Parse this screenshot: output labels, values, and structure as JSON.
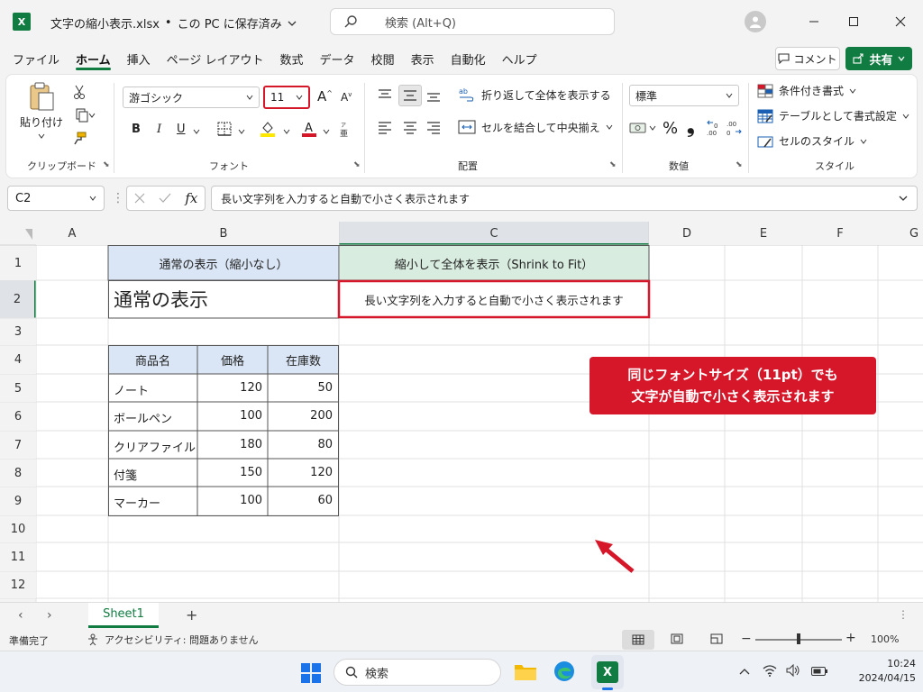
{
  "title_bar": {
    "file_name": "文字の縮小表示.xlsx",
    "dot": "•",
    "save_status": "この PC に保存済み",
    "search_placeholder": "検索 (Alt+Q)"
  },
  "menu": [
    "ファイル",
    "ホーム",
    "挿入",
    "ページ レイアウト",
    "数式",
    "データ",
    "校閲",
    "表示",
    "自動化",
    "ヘルプ"
  ],
  "menu_active": "ホーム",
  "comment_button": "コメント",
  "share_button": "共有",
  "ribbon": {
    "paste_label": "貼り付け",
    "clipboard_group": "クリップボード",
    "font_name": "游ゴシック",
    "font_size": "11",
    "font_group": "フォント",
    "bold": "B",
    "italic": "I",
    "underline": "U",
    "grow_font": "A",
    "shrink_font": "A",
    "wrap_text": "折り返して全体を表示する",
    "merge_center": "セルを結合して中央揃え",
    "alignment_group": "配置",
    "number_format": "標準",
    "percent": "%",
    "comma": "❟",
    "number_group": "数値",
    "conditional_format": "条件付き書式",
    "format_as_table": "テーブルとして書式設定",
    "cell_styles": "セルのスタイル",
    "styles_group": "スタイル",
    "accent": "#107c41"
  },
  "formula_bar": {
    "name_box": "C2",
    "fx": "fx",
    "content": "長い文字列を入力すると自動で小さく表示されます"
  },
  "columns": [
    "A",
    "B",
    "C",
    "D",
    "E",
    "F",
    "G"
  ],
  "rows": [
    "1",
    "2",
    "3",
    "4",
    "5",
    "6",
    "7",
    "8",
    "9",
    "10",
    "11",
    "12"
  ],
  "cells": {
    "B1": "通常の表示（縮小なし）",
    "C1": "縮小して全体を表示（Shrink to Fit）",
    "B2": "通常の表示",
    "C2": "長い文字列を入力すると自動で小さく表示されます"
  },
  "table": {
    "headers": [
      "商品名",
      "価格",
      "在庫数"
    ],
    "rows": [
      [
        "ノート",
        "120",
        "50"
      ],
      [
        "ボールペン",
        "100",
        "200"
      ],
      [
        "クリアファイル",
        "180",
        "80"
      ],
      [
        "付箋",
        "150",
        "120"
      ],
      [
        "マーカー",
        "100",
        "60"
      ]
    ]
  },
  "callout": {
    "line1": "同じフォントサイズ（11pt）でも",
    "line2": "文字が自動で小さく表示されます",
    "color": "#d6172a"
  },
  "sheet_tabs": [
    "Sheet1"
  ],
  "status_bar": {
    "ready": "準備完了",
    "accessibility": "アクセシビリティ: 問題ありません",
    "zoom": "100%"
  },
  "taskbar": {
    "search": "検索",
    "time": "10:24",
    "date": "2024/04/15"
  }
}
